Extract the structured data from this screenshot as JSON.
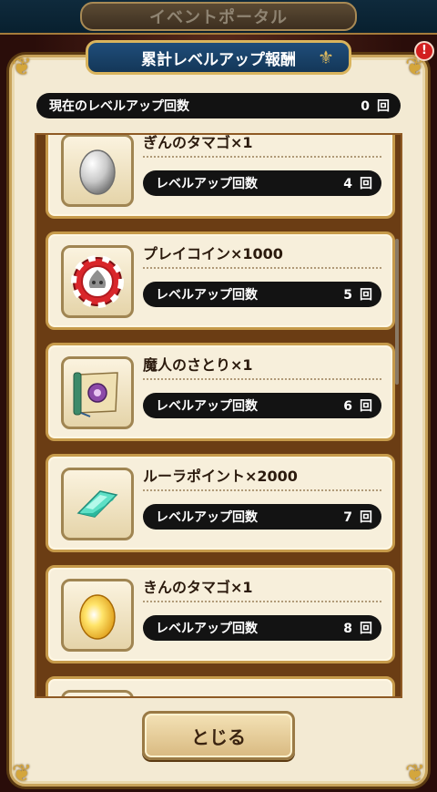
{
  "portal": {
    "title": "イベントポータル"
  },
  "dialog": {
    "title": "累計レベルアップ報酬",
    "current": {
      "label": "現在のレベルアップ回数",
      "value": "0",
      "unit": "回"
    },
    "close_label": "とじる",
    "notification_badge": "!"
  },
  "rewards": [
    {
      "name": "ぎんのタマゴ×1",
      "icon": "silver-egg-icon",
      "req_label": "レベルアップ回数",
      "req_value": "4",
      "unit": "回"
    },
    {
      "name": "プレイコイン×1000",
      "icon": "play-coin-icon",
      "req_label": "レベルアップ回数",
      "req_value": "5",
      "unit": "回"
    },
    {
      "name": "魔人のさとり×1",
      "icon": "scroll-icon",
      "req_label": "レベルアップ回数",
      "req_value": "6",
      "unit": "回"
    },
    {
      "name": "ルーラポイント×2000",
      "icon": "crystal-icon",
      "req_label": "レベルアップ回数",
      "req_value": "7",
      "unit": "回"
    },
    {
      "name": "きんのタマゴ×1",
      "icon": "gold-egg-icon",
      "req_label": "レベルアップ回数",
      "req_value": "8",
      "unit": "回"
    }
  ],
  "colors": {
    "panel": "#f3ead3",
    "ribbon": "#1f4d7a",
    "gold": "#c69a4a",
    "bar": "#131313"
  }
}
